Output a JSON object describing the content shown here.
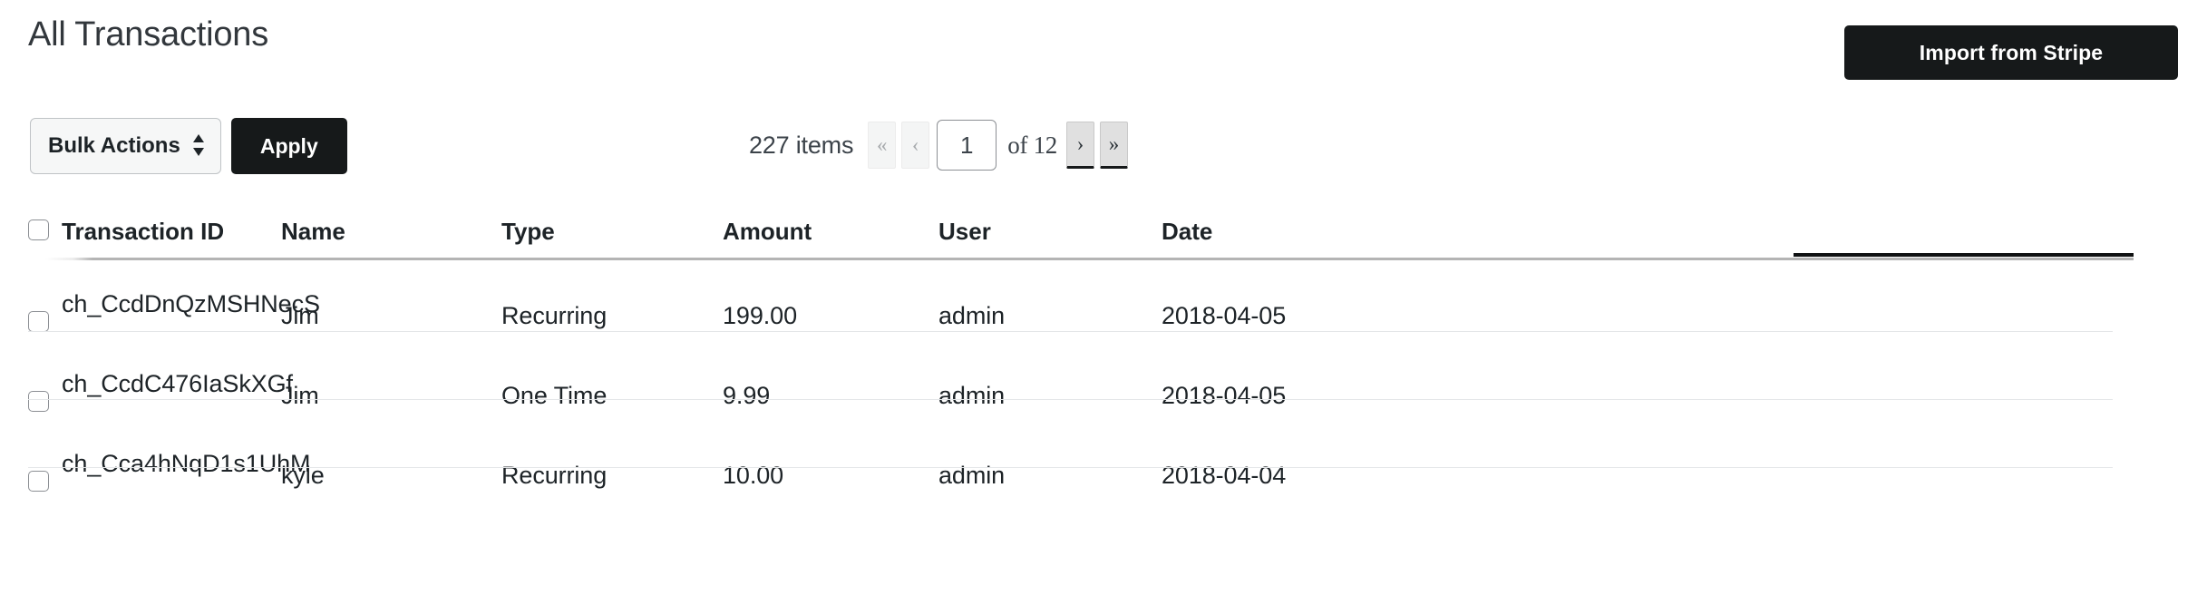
{
  "header": {
    "title": "All Transactions",
    "import_button_label": "Import from Stripe"
  },
  "toolbar": {
    "bulk_actions_label": "Bulk Actions",
    "bulk_actions_arrows": "⬍",
    "apply_label": "Apply"
  },
  "pagination": {
    "items_text": "227 items",
    "first_label": "«",
    "prev_label": "‹",
    "current_page": "1",
    "of_text": "of 12",
    "next_label": "›",
    "last_label": "»"
  },
  "table": {
    "select_all_checkbox": "",
    "columns": [
      {
        "key": "transaction_id",
        "label": "Transaction ID"
      },
      {
        "key": "name",
        "label": "Name"
      },
      {
        "key": "type",
        "label": "Type"
      },
      {
        "key": "amount",
        "label": "Amount"
      },
      {
        "key": "user",
        "label": "User"
      },
      {
        "key": "date",
        "label": "Date"
      }
    ],
    "sorted_column": "date",
    "rows": [
      {
        "transaction_id": "ch_CcdDnQzMSHNecS",
        "name": "Jim",
        "type": "Recurring",
        "amount": "199.00",
        "user": "admin",
        "date": "2018-04-05"
      },
      {
        "transaction_id": "ch_CcdC476IaSkXGf",
        "name": "Jim",
        "type": "One Time",
        "amount": "9.99",
        "user": "admin",
        "date": "2018-04-05"
      },
      {
        "transaction_id": "ch_Cca4hNqD1s1UhM",
        "name": "kyle",
        "type": "Recurring",
        "amount": "10.00",
        "user": "admin",
        "date": "2018-04-04"
      }
    ]
  },
  "colors": {
    "primary_button": "#16191a",
    "text": "#1d2327",
    "rule": "#b4b4b4",
    "active_rule": "#0f1112",
    "row_separator": "#e4e6e8"
  }
}
